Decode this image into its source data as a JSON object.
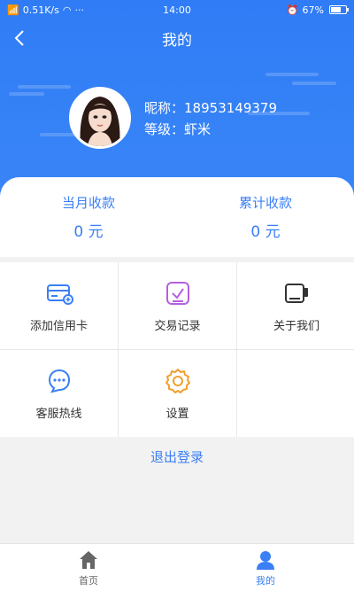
{
  "status_bar": {
    "signal": "0.51K/s",
    "dots": "···",
    "time": "14:00",
    "battery": "67%",
    "battery_level": 0.67
  },
  "navbar": {
    "title": "我的"
  },
  "profile": {
    "nickname_label": "昵称：",
    "nickname_value": "18953149379",
    "level_label": "等级：",
    "level_value": "虾米"
  },
  "stats": [
    {
      "label": "当月收款",
      "value": "0 元"
    },
    {
      "label": "累计收款",
      "value": "0 元"
    }
  ],
  "menu": [
    {
      "label": "添加信用卡",
      "icon": "credit-card-icon",
      "color": "#3b7ff5"
    },
    {
      "label": "交易记录",
      "icon": "record-icon",
      "color": "#b560e0"
    },
    {
      "label": "关于我们",
      "icon": "about-icon",
      "color": "#333333"
    },
    {
      "label": "客服热线",
      "icon": "chat-icon",
      "color": "#3b7ff5"
    },
    {
      "label": "设置",
      "icon": "gear-icon",
      "color": "#f0a030"
    }
  ],
  "logout": {
    "label": "退出登录"
  },
  "tabbar": [
    {
      "label": "首页",
      "icon": "home-icon",
      "active": false
    },
    {
      "label": "我的",
      "icon": "user-icon",
      "active": true
    }
  ],
  "colors": {
    "primary": "#3b7ff5",
    "header": "#2f7cf6",
    "inactive_tab": "#666666"
  }
}
